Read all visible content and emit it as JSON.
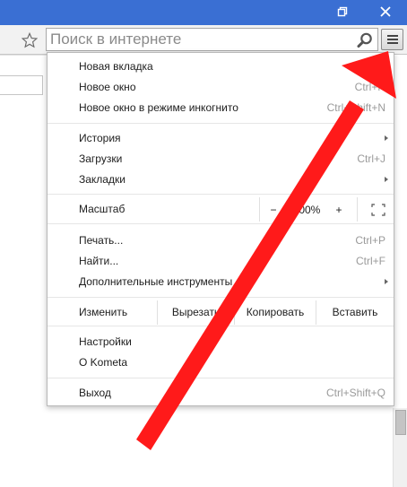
{
  "window": {
    "accent": "#3a6fd3",
    "controls": [
      "restore-icon",
      "close-icon"
    ]
  },
  "toolbar": {
    "search_placeholder": "Поиск в интернете",
    "bookmark_icon": "star-icon",
    "search_icon": "magnifier-icon",
    "menu_icon": "hamburger-icon"
  },
  "menu": {
    "group1": [
      {
        "label": "Новая вкладка",
        "shortcut": "Ctrl+T"
      },
      {
        "label": "Новое окно",
        "shortcut": "Ctrl+N"
      },
      {
        "label": "Новое окно в режиме инкогнито",
        "shortcut": "Ctrl+Shift+N"
      }
    ],
    "group2": [
      {
        "label": "История",
        "submenu": true
      },
      {
        "label": "Загрузки",
        "shortcut": "Ctrl+J"
      },
      {
        "label": "Закладки",
        "submenu": true
      }
    ],
    "zoom": {
      "label": "Масштаб",
      "minus": "−",
      "value": "100%",
      "plus": "+",
      "fullscreen_icon": "fullscreen-icon"
    },
    "group3": [
      {
        "label": "Печать...",
        "shortcut": "Ctrl+P"
      },
      {
        "label": "Найти...",
        "shortcut": "Ctrl+F"
      },
      {
        "label": "Дополнительные инструменты",
        "submenu": true
      }
    ],
    "edit": {
      "label": "Изменить",
      "cut": "Вырезать",
      "copy": "Копировать",
      "paste": "Вставить"
    },
    "group4": [
      {
        "label": "Настройки"
      },
      {
        "label": "О Kometa"
      }
    ],
    "exit": {
      "label": "Выход",
      "shortcut": "Ctrl+Shift+Q"
    }
  },
  "annotation": {
    "color": "#ff1a1a"
  }
}
